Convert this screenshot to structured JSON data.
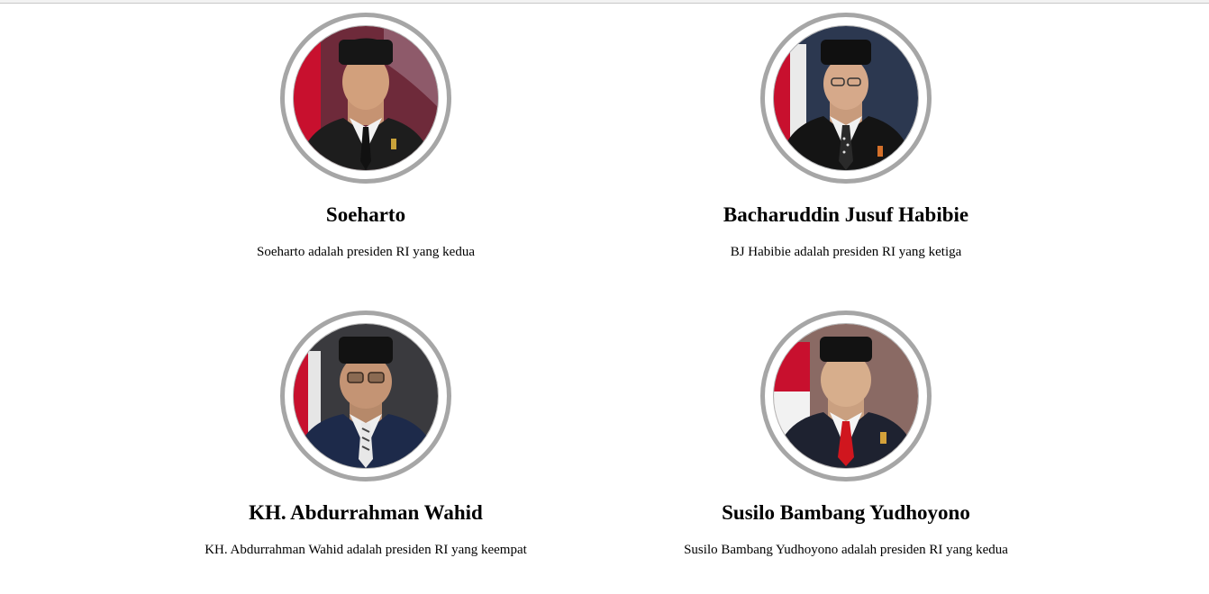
{
  "presidents": [
    {
      "name": "Soeharto",
      "description": "Soeharto adalah presiden RI yang kedua",
      "photo": "portrait-soeharto"
    },
    {
      "name": "Bacharuddin Jusuf Habibie",
      "description": "BJ Habibie adalah presiden RI yang ketiga",
      "photo": "portrait-habibie"
    },
    {
      "name": "KH. Abdurrahman Wahid",
      "description": "KH. Abdurrahman Wahid adalah presiden RI yang keempat",
      "photo": "portrait-wahid"
    },
    {
      "name": "Susilo Bambang Yudhoyono",
      "description": "Susilo Bambang Yudhoyono adalah presiden RI yang kedua",
      "photo": "portrait-sby"
    }
  ],
  "colors": {
    "ring": "#a6a6a6",
    "flag_red": "#c8102e",
    "flag_white": "#f2f2f2"
  }
}
